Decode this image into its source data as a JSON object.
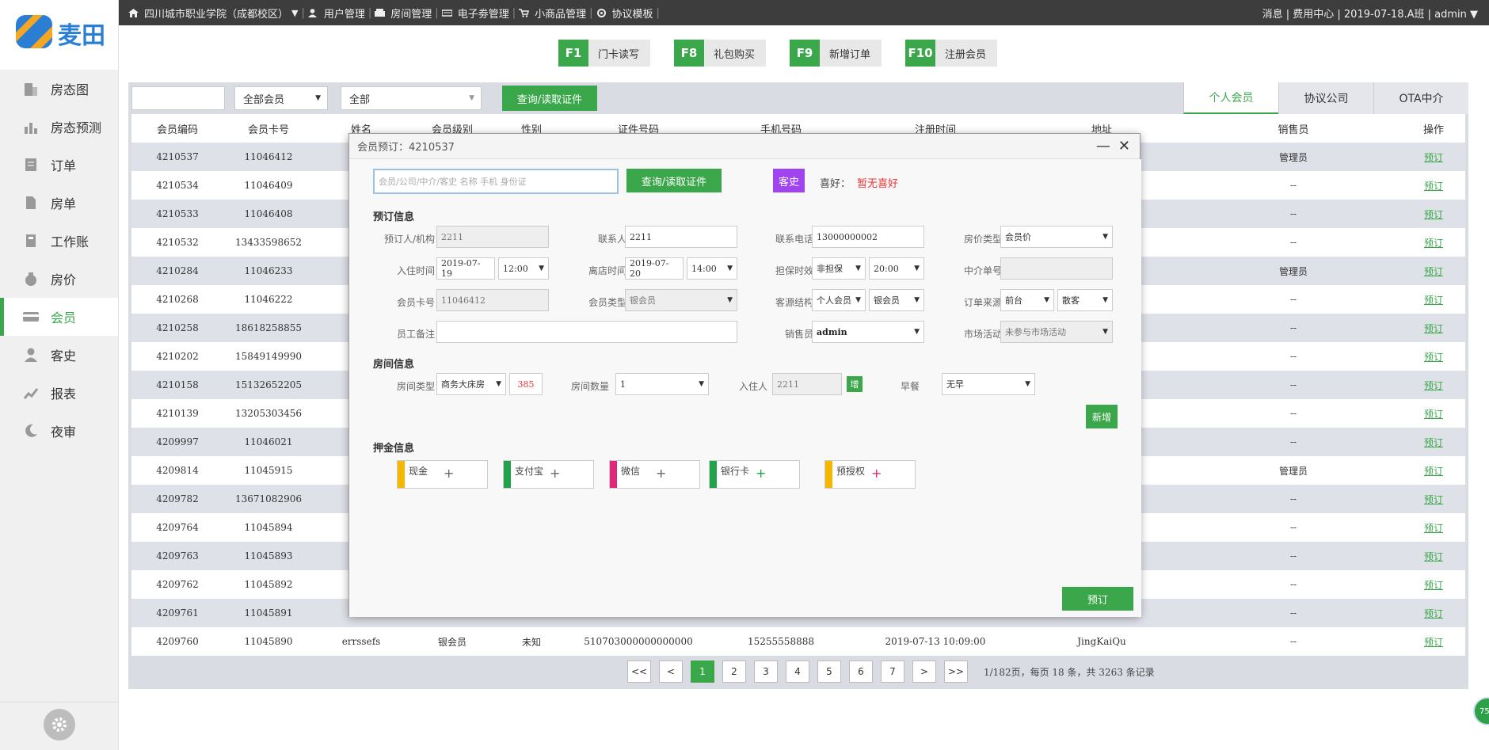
{
  "logo": {
    "name": "麦田"
  },
  "topbar": {
    "school": "四川城市职业学院（成都校区）",
    "dropdown": "▼",
    "menus": [
      "用户管理",
      "房间管理",
      "电子劵管理",
      "小商品管理",
      "协议模板"
    ],
    "right": "消息 | 费用中心 | 2019-07-18.A班 | admin ▼"
  },
  "sidebar": {
    "items": [
      {
        "label": "房态图",
        "icon": "building-icon"
      },
      {
        "label": "房态预测",
        "icon": "bar-chart-icon"
      },
      {
        "label": "订单",
        "icon": "order-icon"
      },
      {
        "label": "房单",
        "icon": "document-icon"
      },
      {
        "label": "工作账",
        "icon": "ledger-icon"
      },
      {
        "label": "房价",
        "icon": "money-bag-icon"
      },
      {
        "label": "会员",
        "icon": "member-card-icon"
      },
      {
        "label": "客史",
        "icon": "user-icon"
      },
      {
        "label": "报表",
        "icon": "trend-icon"
      },
      {
        "label": "夜审",
        "icon": "moon-icon"
      }
    ],
    "active_index": 6
  },
  "fkeys": [
    {
      "key": "F1",
      "label": "门卡读写"
    },
    {
      "key": "F8",
      "label": "礼包购买"
    },
    {
      "key": "F9",
      "label": "新增订单"
    },
    {
      "key": "F10",
      "label": "注册会员"
    }
  ],
  "filters": {
    "search_value": "",
    "member_select": "全部会员",
    "all_select": "全部",
    "query_button": "查询/读取证件"
  },
  "tabs": [
    "个人会员",
    "协议公司",
    "OTA中介"
  ],
  "table": {
    "headers": [
      "会员编码",
      "会员卡号",
      "姓名",
      "会员级别",
      "性别",
      "证件号码",
      "手机号码",
      "注册时间",
      "地址",
      "销售员",
      "操作"
    ],
    "rows": [
      [
        "4210537",
        "11046412",
        "",
        "",
        "",
        "",
        "",
        "",
        "",
        "管理员",
        "预订"
      ],
      [
        "4210534",
        "11046409",
        "",
        "",
        "",
        "",
        "",
        "",
        "",
        "--",
        "预订"
      ],
      [
        "4210533",
        "11046408",
        "",
        "",
        "",
        "",
        "",
        "",
        "",
        "--",
        "预订"
      ],
      [
        "4210532",
        "13433598652",
        "",
        "",
        "",
        "",
        "",
        "",
        "",
        "--",
        "预订"
      ],
      [
        "4210284",
        "11046233",
        "",
        "",
        "",
        "",
        "",
        "",
        "",
        "管理员",
        "预订"
      ],
      [
        "4210268",
        "11046222",
        "",
        "",
        "",
        "",
        "",
        "",
        "",
        "--",
        "预订"
      ],
      [
        "4210258",
        "18618258855",
        "",
        "",
        "",
        "",
        "",
        "",
        "",
        "--",
        "预订"
      ],
      [
        "4210202",
        "15849149990",
        "",
        "",
        "",
        "",
        "",
        "",
        "",
        "--",
        "预订"
      ],
      [
        "4210158",
        "15132652205",
        "",
        "",
        "",
        "",
        "",
        "",
        "",
        "--",
        "预订"
      ],
      [
        "4210139",
        "13205303456",
        "",
        "",
        "",
        "",
        "",
        "",
        "",
        "--",
        "预订"
      ],
      [
        "4209997",
        "11046021",
        "",
        "",
        "",
        "",
        "",
        "",
        "",
        "--",
        "预订"
      ],
      [
        "4209814",
        "11045915",
        "",
        "",
        "",
        "",
        "",
        "",
        "",
        "管理员",
        "预订"
      ],
      [
        "4209782",
        "13671082906",
        "",
        "",
        "",
        "",
        "",
        "",
        "",
        "--",
        "预订"
      ],
      [
        "4209764",
        "11045894",
        "",
        "",
        "",
        "",
        "",
        "",
        "",
        "--",
        "预订"
      ],
      [
        "4209763",
        "11045893",
        "",
        "",
        "",
        "",
        "",
        "",
        "",
        "--",
        "预订"
      ],
      [
        "4209762",
        "11045892",
        "",
        "",
        "",
        "",
        "",
        "",
        "",
        "--",
        "预订"
      ],
      [
        "4209761",
        "11045891",
        "",
        "",
        "",
        "",
        "",
        "",
        "",
        "--",
        "预订"
      ],
      [
        "4209760",
        "11045890",
        "errssefs",
        "银会员",
        "未知",
        "510703000000000000",
        "15255558888",
        "2019-07-13 10:09:00",
        "JingKaiQu",
        "--",
        "预订"
      ]
    ]
  },
  "pager": {
    "first": "<<",
    "prev": "<",
    "pages": [
      "1",
      "2",
      "3",
      "4",
      "5",
      "6",
      "7"
    ],
    "next": ">",
    "last": ">>",
    "current": "1",
    "info": "1/182页，每页 18 条，共 3263 条记录"
  },
  "modal": {
    "title": "会员预订：4210537",
    "minimize": "—",
    "close": "✕",
    "search_placeholder": "会员/公司/中介/客史  名称 手机 身份证",
    "query_button": "查询/读取证件",
    "history_button": "客史",
    "pref_label": "喜好：",
    "pref_value": "暂无喜好",
    "booking_section": "预订信息",
    "booking": {
      "booker_label": "预订人/机构",
      "booker": "2211",
      "contact_label": "联系人",
      "contact": "2211",
      "phone_label": "联系电话",
      "phone": "13000000002",
      "rate_type_label": "房价类型",
      "rate_type": "会员价",
      "checkin_label": "入住时间",
      "checkin_date": "2019-07-19",
      "checkin_time": "12:00",
      "checkout_label": "离店时间",
      "checkout_date": "2019-07-20",
      "checkout_time": "14:00",
      "guarantee_label": "担保时效",
      "guarantee": "非担保",
      "guarantee_time": "20:00",
      "agent_no_label": "中介单号",
      "agent_no": "",
      "card_label": "会员卡号",
      "card": "11046412",
      "member_type_label": "会员类型",
      "member_type": "银会员",
      "source_label": "客源结构",
      "source1": "个人会员",
      "source2": "银会员",
      "order_source_label": "订单来源",
      "order_source1": "前台",
      "order_source2": "散客",
      "remark_label": "员工备注",
      "remark": "",
      "sales_label": "销售员",
      "sales": "admin",
      "market_label": "市场活动",
      "market": "未参与市场活动"
    },
    "room_section": "房间信息",
    "room": {
      "type_label": "房间类型",
      "type": "商务大床房",
      "price": "385",
      "count_label": "房间数量",
      "count": "1",
      "guest_label": "入住人",
      "guest": "2211",
      "add_guest": "增",
      "breakfast_label": "早餐",
      "breakfast": "无早"
    },
    "add_button": "新增",
    "deposit_section": "押金信息",
    "deposits": [
      {
        "label": "现金",
        "color": "#f5b800"
      },
      {
        "label": "支付宝",
        "color": "#22a24a"
      },
      {
        "label": "微信",
        "color": "#e0287a"
      },
      {
        "label": "银行卡",
        "color": "#22a24a"
      },
      {
        "label": "预授权",
        "color": "#f5b800"
      }
    ],
    "deposit_plus": "+",
    "book_button": "预订"
  },
  "float_badge": "75"
}
